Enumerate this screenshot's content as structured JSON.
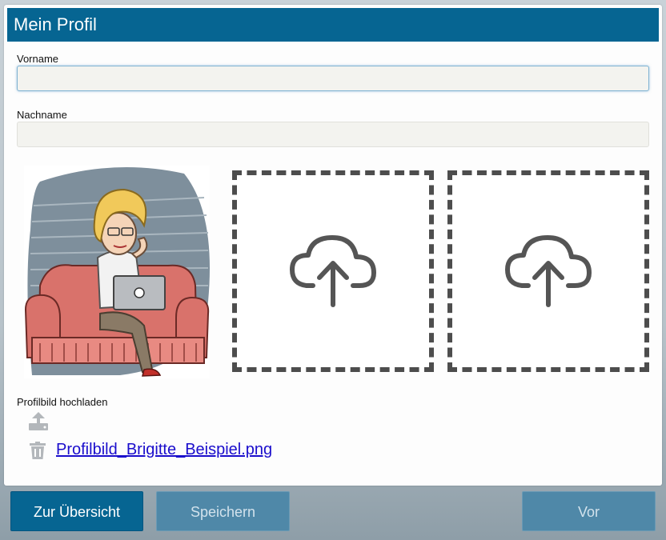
{
  "header": {
    "title": "Mein Profil"
  },
  "form": {
    "first_name": {
      "label": "Vorname",
      "value": ""
    },
    "last_name": {
      "label": "Nachname",
      "value": ""
    }
  },
  "profile_image": {
    "upload_label": "Profilbild hochladen",
    "file_name": "Profilbild_Brigitte_Beispiel.png"
  },
  "icons": {
    "upload_slot": "cloud-upload-icon",
    "upload_small": "upload-icon",
    "delete": "trash-icon"
  },
  "footer": {
    "overview_label": "Zur Übersicht",
    "save_label": "Speichern",
    "next_label": "Vor"
  },
  "colors": {
    "header_bg": "#066592",
    "primary_button": "#066592",
    "disabled_button": "#4f88a8",
    "link": "#1a0dcc"
  }
}
